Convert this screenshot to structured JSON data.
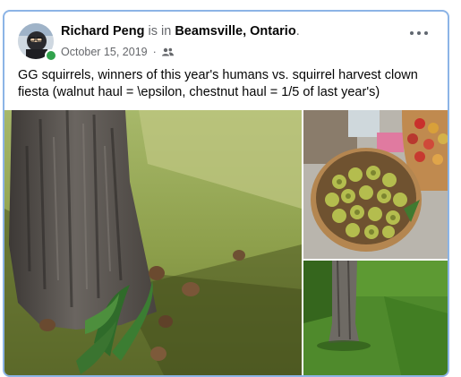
{
  "post": {
    "author_name": "Richard Peng",
    "is_in_text": " is in ",
    "location": "Beamsville, Ontario",
    "trailing_period": ".",
    "date": "October 15, 2019",
    "separator": "·",
    "audience_icon": "friends-icon",
    "more_icon": "more-options-icon",
    "text": "GG squirrels, winners of this year's humans vs. squirrel harvest clown fiesta (walnut haul = \\epsilon, chestnut haul = 1/5 of last year's)"
  },
  "photos": {
    "count": 3
  },
  "colors": {
    "card_border": "#8cb4e6",
    "online_dot": "#31a24c",
    "secondary_text": "#65676b"
  }
}
